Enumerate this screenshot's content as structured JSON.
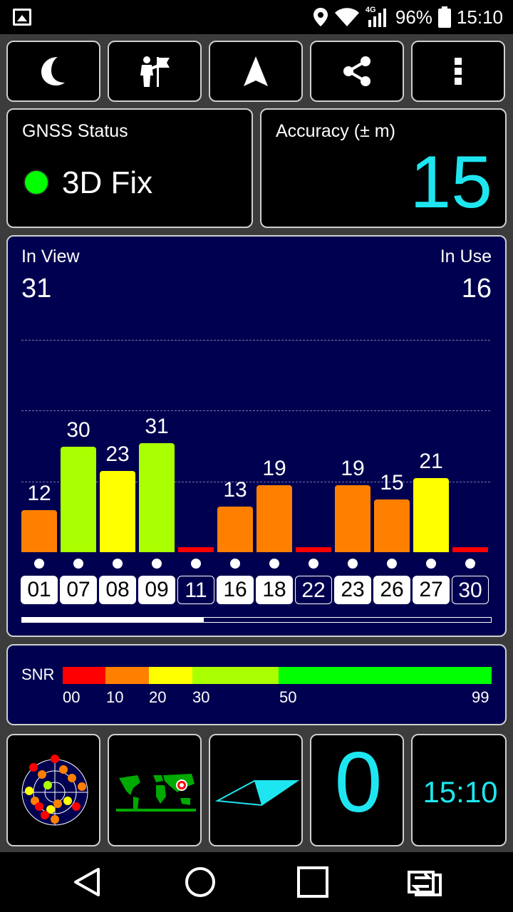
{
  "status_bar": {
    "network": "4G",
    "battery": "96%",
    "time": "15:10",
    "icons": [
      "gallery-icon",
      "location-pin-icon",
      "wifi-icon",
      "signal-icon",
      "battery-icon"
    ]
  },
  "toolbar": {
    "buttons": [
      {
        "icon": "moon-icon"
      },
      {
        "icon": "person-flag-icon"
      },
      {
        "icon": "navigation-arrow-icon"
      },
      {
        "icon": "share-icon"
      },
      {
        "icon": "more-vert-icon"
      }
    ]
  },
  "gnss": {
    "title": "GNSS Status",
    "fix": "3D Fix",
    "fix_color": "#00ff00"
  },
  "accuracy": {
    "title": "Accuracy (± m)",
    "value": "15",
    "color": "#1ee6f0"
  },
  "satellites": {
    "in_view_label": "In View",
    "in_view": "31",
    "in_use_label": "In Use",
    "in_use": "16"
  },
  "chart_data": {
    "type": "bar",
    "categories": [
      "01",
      "07",
      "08",
      "09",
      "11",
      "16",
      "18",
      "22",
      "23",
      "26",
      "27",
      "30"
    ],
    "values": [
      12,
      30,
      23,
      31,
      0,
      13,
      19,
      0,
      19,
      15,
      21,
      0
    ],
    "in_use": [
      true,
      true,
      true,
      true,
      false,
      true,
      true,
      false,
      true,
      true,
      true,
      false
    ],
    "ylim": [
      0,
      40
    ],
    "grid": true
  },
  "snr_legend": {
    "label": "SNR",
    "ticks": [
      "00",
      "10",
      "20",
      "30",
      "50",
      "99"
    ],
    "colors": [
      "#ff0000",
      "#ff8000",
      "#ffff00",
      "#aaff00",
      "#00ff00"
    ]
  },
  "bottom_tiles": {
    "sky_view": "sky-plot-icon",
    "world_map": "world-map-icon",
    "compass": "compass-icon",
    "speed": "0",
    "clock": "15:10",
    "accent": "#1ee6f0"
  },
  "navbar": {
    "buttons": [
      "back-icon",
      "home-icon",
      "recents-icon",
      "switch-app-icon"
    ]
  }
}
